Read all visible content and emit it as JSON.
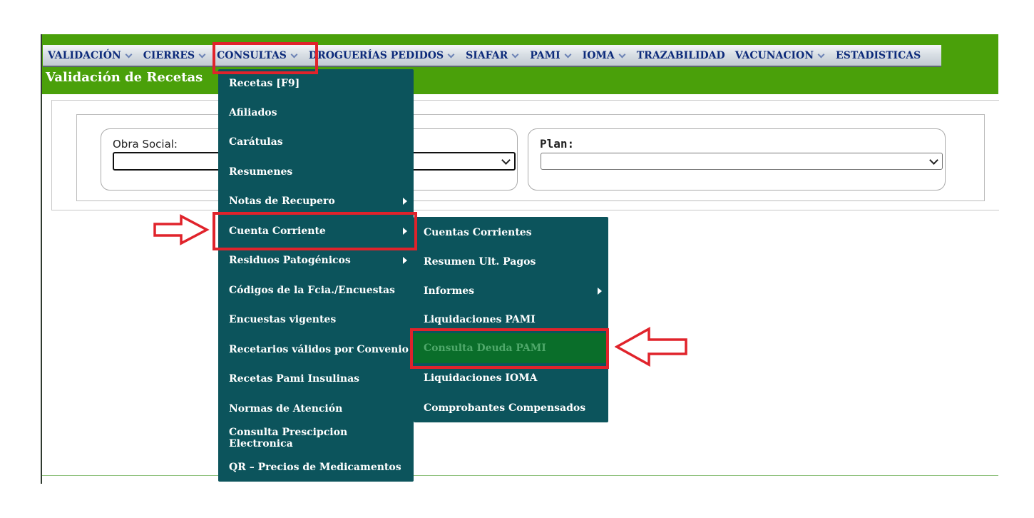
{
  "menubar": {
    "items": [
      {
        "label": "VALIDACIÓN",
        "dropdown": true
      },
      {
        "label": "CIERRES",
        "dropdown": true
      },
      {
        "label": "CONSULTAS",
        "dropdown": true
      },
      {
        "label": "DROGUERÍAS PEDIDOS",
        "dropdown": true
      },
      {
        "label": "SIAFAR",
        "dropdown": true
      },
      {
        "label": "PAMI",
        "dropdown": true
      },
      {
        "label": "IOMA",
        "dropdown": true
      },
      {
        "label": "TRAZABILIDAD",
        "dropdown": false
      },
      {
        "label": "VACUNACION",
        "dropdown": true
      },
      {
        "label": "ESTADISTICAS",
        "dropdown": false
      }
    ]
  },
  "page": {
    "title": "Validación de Recetas"
  },
  "form": {
    "obra_social_label": "Obra Social:",
    "obra_social_value": "",
    "plan_label": "Plan:",
    "plan_value": ""
  },
  "consultas_menu": {
    "items": [
      {
        "label": "Recetas [F9]",
        "submenu": false
      },
      {
        "label": "Afiliados",
        "submenu": false
      },
      {
        "label": "Carátulas",
        "submenu": false
      },
      {
        "label": "Resumenes",
        "submenu": false
      },
      {
        "label": "Notas de Recupero",
        "submenu": true
      },
      {
        "label": "Cuenta Corriente",
        "submenu": true
      },
      {
        "label": "Residuos Patogénicos",
        "submenu": true
      },
      {
        "label": "Códigos de la Fcia./Encuestas",
        "submenu": false
      },
      {
        "label": "Encuestas vigentes",
        "submenu": false
      },
      {
        "label": "Recetarios válidos por Convenio",
        "submenu": false
      },
      {
        "label": "Recetas Pami Insulinas",
        "submenu": false
      },
      {
        "label": "Normas de Atención",
        "submenu": false
      },
      {
        "label": "Consulta Prescipcion Electronica",
        "submenu": false
      },
      {
        "label": "QR – Precios de Medicamentos",
        "submenu": false
      }
    ]
  },
  "cuenta_corriente_submenu": {
    "items": [
      {
        "label": "Cuentas Corrientes",
        "submenu": false
      },
      {
        "label": "Resumen Ult. Pagos",
        "submenu": false
      },
      {
        "label": "Informes",
        "submenu": true
      },
      {
        "label": "Liquidaciones PAMI",
        "submenu": false
      },
      {
        "label": "Consulta Deuda PAMI",
        "submenu": false,
        "active": true
      },
      {
        "label": "Liquidaciones IOMA",
        "submenu": false
      },
      {
        "label": "Comprobantes Compensados",
        "submenu": false
      }
    ]
  },
  "colors": {
    "header_green": "#4aa00a",
    "menu_teal": "#0c545c",
    "active_item": "#0a6e2a",
    "annotation_red": "#e0232b"
  }
}
